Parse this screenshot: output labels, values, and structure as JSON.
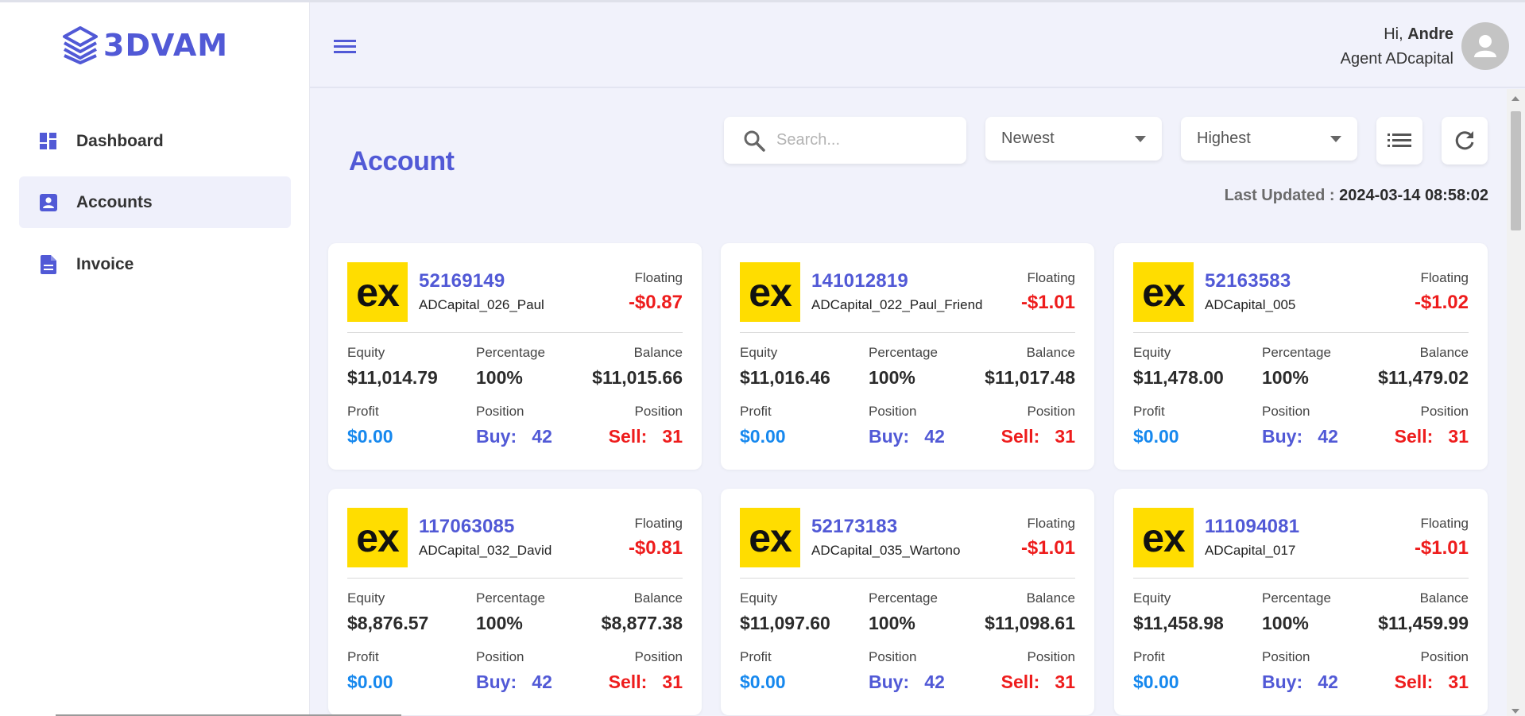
{
  "brand": {
    "name": "3DVAM"
  },
  "sidebar": {
    "items": [
      {
        "label": "Dashboard",
        "icon": "dashboard-icon"
      },
      {
        "label": "Accounts",
        "icon": "account-box-icon",
        "active": true
      },
      {
        "label": "Invoice",
        "icon": "document-icon"
      }
    ]
  },
  "header": {
    "greeting_prefix": "Hi,",
    "user_name": "Andre",
    "user_role": "Agent ADcapital"
  },
  "main": {
    "title": "Account",
    "search_placeholder": "Search...",
    "sort_select": "Newest",
    "order_select": "Highest",
    "last_updated_label": "Last Updated :",
    "last_updated_value": "2024-03-14 08:58:02"
  },
  "labels": {
    "floating": "Floating",
    "equity": "Equity",
    "percentage": "Percentage",
    "balance": "Balance",
    "profit": "Profit",
    "position": "Position"
  },
  "accounts": [
    {
      "logo": "ex",
      "number": "52169149",
      "name": "ADCapital_026_Paul",
      "floating": "-$0.87",
      "equity": "$11,014.79",
      "percentage": "100%",
      "balance": "$11,015.66",
      "profit": "$0.00",
      "buy": "Buy:   42",
      "sell": "Sell:   31"
    },
    {
      "logo": "ex",
      "number": "141012819",
      "name": "ADCapital_022_Paul_Friend",
      "floating": "-$1.01",
      "equity": "$11,016.46",
      "percentage": "100%",
      "balance": "$11,017.48",
      "profit": "$0.00",
      "buy": "Buy:   42",
      "sell": "Sell:   31"
    },
    {
      "logo": "ex",
      "number": "52163583",
      "name": "ADCapital_005",
      "floating": "-$1.02",
      "equity": "$11,478.00",
      "percentage": "100%",
      "balance": "$11,479.02",
      "profit": "$0.00",
      "buy": "Buy:   42",
      "sell": "Sell:   31"
    },
    {
      "logo": "ex",
      "number": "117063085",
      "name": "ADCapital_032_David",
      "floating": "-$0.81",
      "equity": "$8,876.57",
      "percentage": "100%",
      "balance": "$8,877.38",
      "profit": "$0.00",
      "buy": "Buy:   42",
      "sell": "Sell:   31"
    },
    {
      "logo": "ex",
      "number": "52173183",
      "name": "ADCapital_035_Wartono",
      "floating": "-$1.01",
      "equity": "$11,097.60",
      "percentage": "100%",
      "balance": "$11,098.61",
      "profit": "$0.00",
      "buy": "Buy:   42",
      "sell": "Sell:   31"
    },
    {
      "logo": "ex",
      "number": "111094081",
      "name": "ADCapital_017",
      "floating": "-$1.01",
      "equity": "$11,458.98",
      "percentage": "100%",
      "balance": "$11,459.99",
      "profit": "$0.00",
      "buy": "Buy:   42",
      "sell": "Sell:   31"
    }
  ],
  "colors": {
    "accent": "#5159d6",
    "negative": "#ee1c1c",
    "profit": "#1688ee",
    "logo_yellow": "#ffdd00"
  }
}
